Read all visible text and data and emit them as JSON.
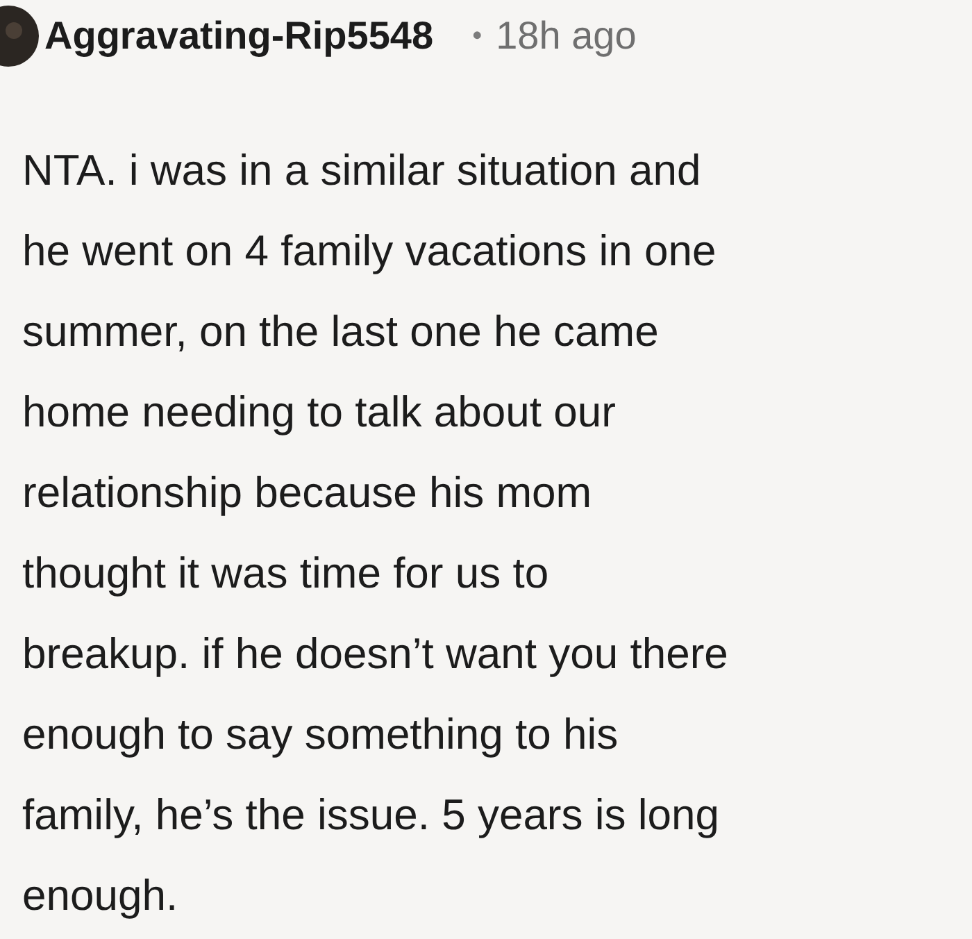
{
  "comment": {
    "author": "Aggravating-Rip5548",
    "separator": "•",
    "time": "18h ago",
    "body": "NTA. i was in a similar situation and\nhe went on 4 family vacations in one\nsummer, on the last one he came\nhome needing to talk about our\nrelationship because his mom\nthought it was time for us to\nbreakup. if he doesn’t want you there\nenough to say something to his\nfamily, he’s the issue. 5 years is long\nenough."
  }
}
